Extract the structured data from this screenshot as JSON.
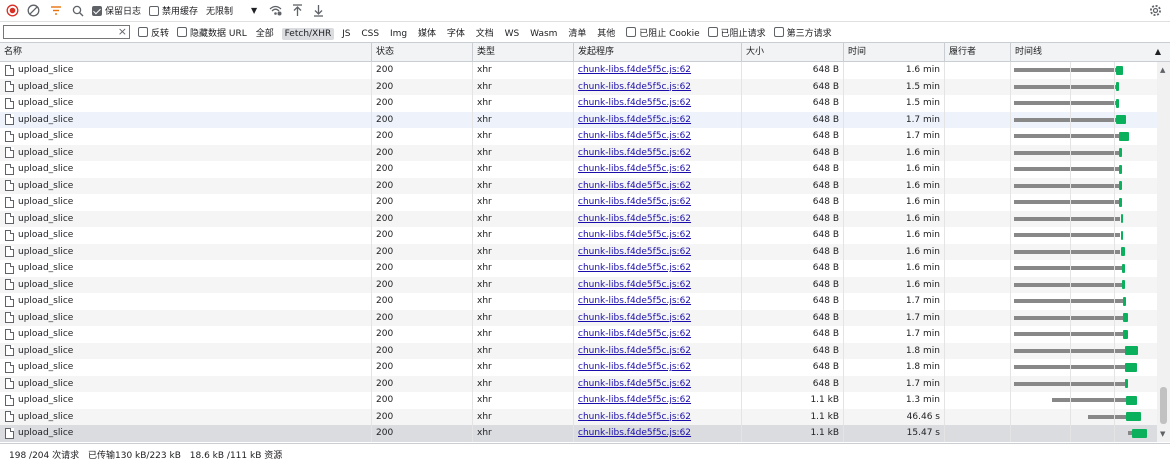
{
  "toolbar": {
    "preserve_log_label": "保留日志",
    "disable_cache_label": "禁用缓存",
    "throttle_label": "无限制"
  },
  "filterbar": {
    "filter_value": "",
    "invert_label": "反转",
    "hide_data_url_label": "隐藏数据 URL",
    "types": [
      "全部",
      "Fetch/XHR",
      "JS",
      "CSS",
      "Img",
      "媒体",
      "字体",
      "文档",
      "WS",
      "Wasm",
      "清单",
      "其他"
    ],
    "active_type": "Fetch/XHR",
    "blocked_cookie_label": "已阻止 Cookie",
    "blocked_requests_label": "已阻止请求",
    "third_party_label": "第三方请求"
  },
  "columns": {
    "name": "名称",
    "status": "状态",
    "type": "类型",
    "initiator": "发起程序",
    "size": "大小",
    "time": "时间",
    "fulfilled_by": "履行者",
    "waterfall": "时间线"
  },
  "rows": [
    {
      "name": "upload_slice",
      "status": "200",
      "type": "xhr",
      "initiator": "chunk-libs.f4de5f5c.js:62",
      "size": "648 B",
      "time": "1.6 min",
      "wf": {
        "start": 0.02,
        "wait": 0.7,
        "dl": 0.05
      }
    },
    {
      "name": "upload_slice",
      "status": "200",
      "type": "xhr",
      "initiator": "chunk-libs.f4de5f5c.js:62",
      "size": "648 B",
      "time": "1.5 min",
      "wf": {
        "start": 0.02,
        "wait": 0.7,
        "dl": 0.02
      }
    },
    {
      "name": "upload_slice",
      "status": "200",
      "type": "xhr",
      "initiator": "chunk-libs.f4de5f5c.js:62",
      "size": "648 B",
      "time": "1.5 min",
      "wf": {
        "start": 0.02,
        "wait": 0.7,
        "dl": 0.02
      }
    },
    {
      "name": "upload_slice",
      "status": "200",
      "type": "xhr",
      "initiator": "chunk-libs.f4de5f5c.js:62",
      "size": "648 B",
      "time": "1.7 min",
      "wf": {
        "start": 0.02,
        "wait": 0.7,
        "dl": 0.07
      }
    },
    {
      "name": "upload_slice",
      "status": "200",
      "type": "xhr",
      "initiator": "chunk-libs.f4de5f5c.js:62",
      "size": "648 B",
      "time": "1.7 min",
      "wf": {
        "start": 0.02,
        "wait": 0.72,
        "dl": 0.07
      }
    },
    {
      "name": "upload_slice",
      "status": "200",
      "type": "xhr",
      "initiator": "chunk-libs.f4de5f5c.js:62",
      "size": "648 B",
      "time": "1.6 min",
      "wf": {
        "start": 0.02,
        "wait": 0.72,
        "dl": 0.02
      }
    },
    {
      "name": "upload_slice",
      "status": "200",
      "type": "xhr",
      "initiator": "chunk-libs.f4de5f5c.js:62",
      "size": "648 B",
      "time": "1.6 min",
      "wf": {
        "start": 0.02,
        "wait": 0.72,
        "dl": 0.02
      }
    },
    {
      "name": "upload_slice",
      "status": "200",
      "type": "xhr",
      "initiator": "chunk-libs.f4de5f5c.js:62",
      "size": "648 B",
      "time": "1.6 min",
      "wf": {
        "start": 0.02,
        "wait": 0.72,
        "dl": 0.02
      }
    },
    {
      "name": "upload_slice",
      "status": "200",
      "type": "xhr",
      "initiator": "chunk-libs.f4de5f5c.js:62",
      "size": "648 B",
      "time": "1.6 min",
      "wf": {
        "start": 0.02,
        "wait": 0.72,
        "dl": 0.02
      }
    },
    {
      "name": "upload_slice",
      "status": "200",
      "type": "xhr",
      "initiator": "chunk-libs.f4de5f5c.js:62",
      "size": "648 B",
      "time": "1.6 min",
      "wf": {
        "start": 0.02,
        "wait": 0.73,
        "dl": 0.02
      }
    },
    {
      "name": "upload_slice",
      "status": "200",
      "type": "xhr",
      "initiator": "chunk-libs.f4de5f5c.js:62",
      "size": "648 B",
      "time": "1.6 min",
      "wf": {
        "start": 0.02,
        "wait": 0.73,
        "dl": 0.02
      }
    },
    {
      "name": "upload_slice",
      "status": "200",
      "type": "xhr",
      "initiator": "chunk-libs.f4de5f5c.js:62",
      "size": "648 B",
      "time": "1.6 min",
      "wf": {
        "start": 0.02,
        "wait": 0.73,
        "dl": 0.03
      }
    },
    {
      "name": "upload_slice",
      "status": "200",
      "type": "xhr",
      "initiator": "chunk-libs.f4de5f5c.js:62",
      "size": "648 B",
      "time": "1.6 min",
      "wf": {
        "start": 0.02,
        "wait": 0.74,
        "dl": 0.02
      }
    },
    {
      "name": "upload_slice",
      "status": "200",
      "type": "xhr",
      "initiator": "chunk-libs.f4de5f5c.js:62",
      "size": "648 B",
      "time": "1.6 min",
      "wf": {
        "start": 0.02,
        "wait": 0.74,
        "dl": 0.02
      }
    },
    {
      "name": "upload_slice",
      "status": "200",
      "type": "xhr",
      "initiator": "chunk-libs.f4de5f5c.js:62",
      "size": "648 B",
      "time": "1.7 min",
      "wf": {
        "start": 0.02,
        "wait": 0.75,
        "dl": 0.02
      }
    },
    {
      "name": "upload_slice",
      "status": "200",
      "type": "xhr",
      "initiator": "chunk-libs.f4de5f5c.js:62",
      "size": "648 B",
      "time": "1.7 min",
      "wf": {
        "start": 0.02,
        "wait": 0.75,
        "dl": 0.03
      }
    },
    {
      "name": "upload_slice",
      "status": "200",
      "type": "xhr",
      "initiator": "chunk-libs.f4de5f5c.js:62",
      "size": "648 B",
      "time": "1.7 min",
      "wf": {
        "start": 0.02,
        "wait": 0.75,
        "dl": 0.03
      }
    },
    {
      "name": "upload_slice",
      "status": "200",
      "type": "xhr",
      "initiator": "chunk-libs.f4de5f5c.js:62",
      "size": "648 B",
      "time": "1.8 min",
      "wf": {
        "start": 0.02,
        "wait": 0.76,
        "dl": 0.09
      }
    },
    {
      "name": "upload_slice",
      "status": "200",
      "type": "xhr",
      "initiator": "chunk-libs.f4de5f5c.js:62",
      "size": "648 B",
      "time": "1.8 min",
      "wf": {
        "start": 0.02,
        "wait": 0.76,
        "dl": 0.08
      }
    },
    {
      "name": "upload_slice",
      "status": "200",
      "type": "xhr",
      "initiator": "chunk-libs.f4de5f5c.js:62",
      "size": "648 B",
      "time": "1.7 min",
      "wf": {
        "start": 0.02,
        "wait": 0.76,
        "dl": 0.02
      }
    },
    {
      "name": "upload_slice",
      "status": "200",
      "type": "xhr",
      "initiator": "chunk-libs.f4de5f5c.js:62",
      "size": "1.1 kB",
      "time": "1.3 min",
      "wf": {
        "start": 0.28,
        "wait": 0.51,
        "dl": 0.07
      }
    },
    {
      "name": "upload_slice",
      "status": "200",
      "type": "xhr",
      "initiator": "chunk-libs.f4de5f5c.js:62",
      "size": "1.1 kB",
      "time": "46.46 s",
      "wf": {
        "start": 0.53,
        "wait": 0.26,
        "dl": 0.1
      }
    },
    {
      "name": "upload_slice",
      "status": "200",
      "type": "xhr",
      "initiator": "chunk-libs.f4de5f5c.js:62",
      "size": "1.1 kB",
      "time": "15.47 s",
      "wf": {
        "start": 0.8,
        "wait": 0.03,
        "dl": 0.1
      }
    }
  ],
  "status_bar": {
    "requests": "198 /204 次请求",
    "transferred": "已传输130 kB/223 kB",
    "resources": "18.6 kB /111 kB 资源"
  },
  "colors": {
    "record": "#d93025",
    "filter_active": "#e8710a",
    "waterfall_wait": "#888888",
    "waterfall_download": "#0bb05c",
    "link": "#1a0dab"
  },
  "icons": [
    "record-stop-icon",
    "clear-icon",
    "filter-icon",
    "search-icon",
    "wifi-icon",
    "upload-icon",
    "download-icon",
    "settings-icon",
    "document-icon"
  ]
}
